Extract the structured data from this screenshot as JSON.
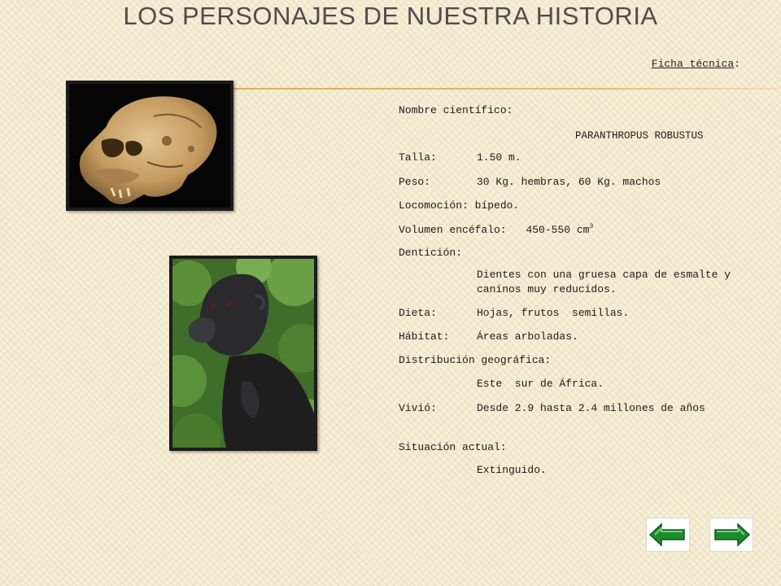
{
  "slide": {
    "title": "LOS PERSONAJES DE NUESTRA HISTORIA",
    "ficha_label": "Ficha técnica",
    "ficha_colon": ":"
  },
  "info": {
    "nombre_label": "Nombre científico:",
    "species": "PARANTHROPUS ROBUSTUS",
    "talla_label": "Talla:",
    "talla_value": "1.50 m.",
    "peso_label": "Peso:",
    "peso_value": "30 Kg. hembras, 60 Kg. machos",
    "locomocion": "Locomoción: bípedo.",
    "volumen_label": "Volumen encéfalo:",
    "volumen_value": "450-550 cm",
    "volumen_sup": "3",
    "denticion_label": "Dentición:",
    "denticion_value": "Dientes con una gruesa capa de esmalte y caninos muy reducidos.",
    "dieta_label": "Dieta:",
    "dieta_value": "Hojas, frutos  semillas.",
    "habitat_label": "Hábitat:",
    "habitat_value": "Áreas arboladas.",
    "distribucion_label": "Distribución geográfica:",
    "distribucion_value": "Este  sur de África.",
    "vivio_label": "Vivió:",
    "vivio_value": "Desde 2.9 hasta 2.4 millones de años",
    "situacion_label": "Situación actual:",
    "situacion_value": "Extinguido."
  },
  "colors": {
    "accent_rule": "#e2ae55",
    "nav_arrow": "#1e8a2e",
    "title_text": "#4d4d4d"
  },
  "icons": {
    "prev": "left-arrow-icon",
    "next": "right-arrow-icon"
  }
}
